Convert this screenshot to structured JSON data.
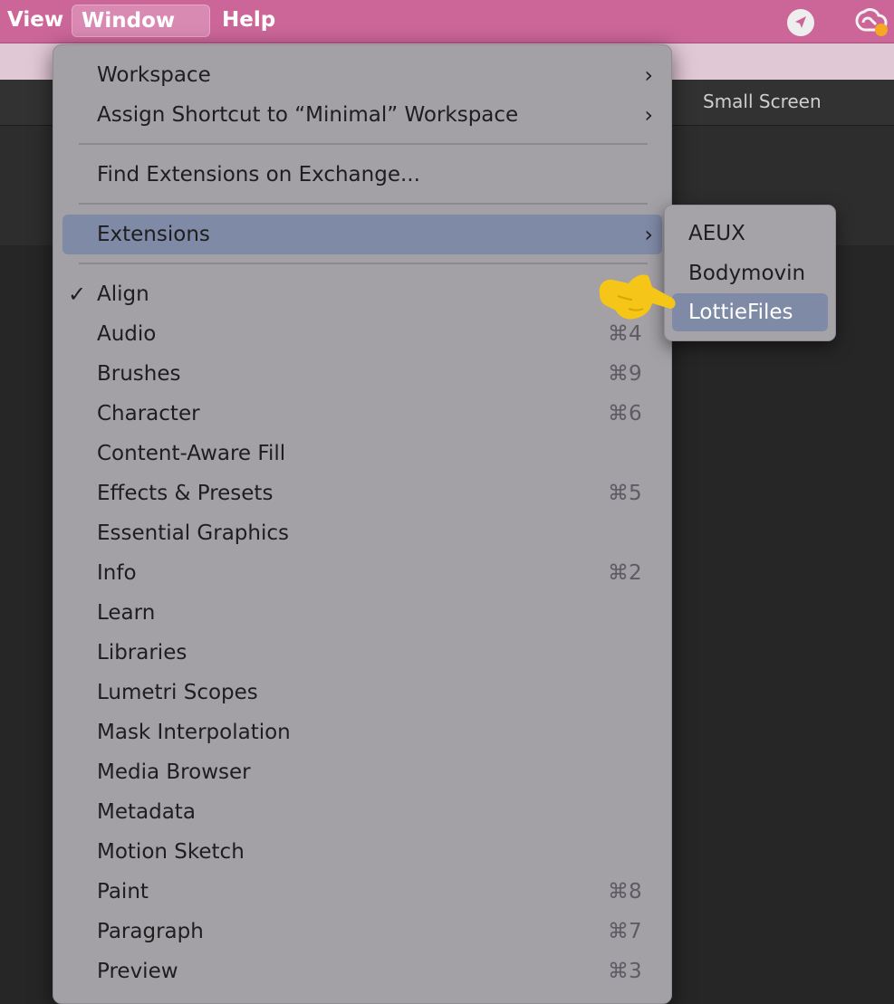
{
  "menubar": {
    "items": [
      {
        "label": "View"
      },
      {
        "label": "Window"
      },
      {
        "label": "Help"
      }
    ],
    "icons": [
      "location-arrow-icon",
      "creative-cloud-icon"
    ]
  },
  "workspace": {
    "label": "Small Screen"
  },
  "window_menu": {
    "items": [
      {
        "label": "Workspace",
        "submenu": true
      },
      {
        "label": "Assign Shortcut to “Minimal” Workspace",
        "submenu": true
      },
      {
        "label": "Find Extensions on Exchange..."
      },
      {
        "label": "Extensions",
        "submenu": true,
        "highlighted": true
      },
      {
        "label": "Align",
        "checked": true
      },
      {
        "label": "Audio",
        "shortcut": "⌘4"
      },
      {
        "label": "Brushes",
        "shortcut": "⌘9"
      },
      {
        "label": "Character",
        "shortcut": "⌘6"
      },
      {
        "label": "Content-Aware Fill"
      },
      {
        "label": "Effects & Presets",
        "shortcut": "⌘5"
      },
      {
        "label": "Essential Graphics"
      },
      {
        "label": "Info",
        "shortcut": "⌘2"
      },
      {
        "label": "Learn"
      },
      {
        "label": "Libraries"
      },
      {
        "label": "Lumetri Scopes"
      },
      {
        "label": "Mask Interpolation"
      },
      {
        "label": "Media Browser"
      },
      {
        "label": "Metadata"
      },
      {
        "label": "Motion Sketch"
      },
      {
        "label": "Paint",
        "shortcut": "⌘8"
      },
      {
        "label": "Paragraph",
        "shortcut": "⌘7"
      },
      {
        "label": "Preview",
        "shortcut": "⌘3"
      }
    ],
    "check_glyph": "✓",
    "chevron_glyph": "›"
  },
  "extensions_submenu": {
    "items": [
      {
        "label": "AEUX"
      },
      {
        "label": "Bodymovin"
      },
      {
        "label": "LottieFiles",
        "highlighted": true
      }
    ]
  },
  "colors": {
    "menubar": "#cc6699",
    "highlight": "#7f8aa6",
    "pointer": "#f5c518"
  }
}
